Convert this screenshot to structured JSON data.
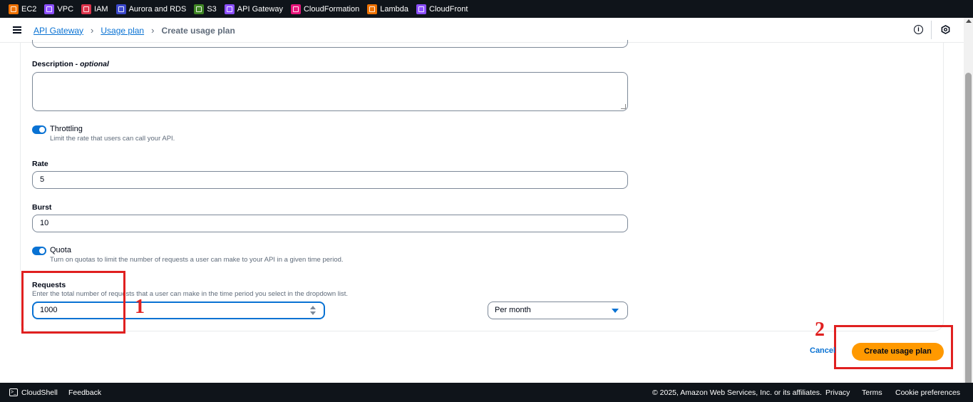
{
  "top_services": [
    {
      "label": "EC2",
      "color": "#ed7100",
      "icon": "ec2-icon"
    },
    {
      "label": "VPC",
      "color": "#8c4fff",
      "icon": "vpc-icon"
    },
    {
      "label": "IAM",
      "color": "#dd344c",
      "icon": "iam-icon"
    },
    {
      "label": "Aurora and RDS",
      "color": "#3b48cc",
      "icon": "rds-icon"
    },
    {
      "label": "S3",
      "color": "#3f8624",
      "icon": "s3-icon"
    },
    {
      "label": "API Gateway",
      "color": "#8c4fff",
      "icon": "api-gateway-icon"
    },
    {
      "label": "CloudFormation",
      "color": "#e7157b",
      "icon": "cloudformation-icon"
    },
    {
      "label": "Lambda",
      "color": "#ed7100",
      "icon": "lambda-icon"
    },
    {
      "label": "CloudFront",
      "color": "#8c4fff",
      "icon": "cloudfront-icon"
    }
  ],
  "breadcrumb": {
    "items": [
      "API Gateway",
      "Usage plan"
    ],
    "current": "Create usage plan",
    "separator": "›"
  },
  "header_icons": {
    "info": "i"
  },
  "form": {
    "description_label": "Description - ",
    "description_optional": "optional",
    "throttling_label": "Throttling",
    "throttling_desc": "Limit the rate that users can call your API.",
    "throttling_on": true,
    "rate_label": "Rate",
    "rate_value": "5",
    "burst_label": "Burst",
    "burst_value": "10",
    "quota_label": "Quota",
    "quota_desc": "Turn on quotas to limit the number of requests a user can make to your API in a given time period.",
    "quota_on": true,
    "requests_label": "Requests",
    "requests_desc": "Enter the total number of requests that a user can make in the time period you select in the dropdown list.",
    "requests_value": "1000",
    "period_value": "Per month"
  },
  "annotations": {
    "one": "1",
    "two": "2",
    "color": "#e02020"
  },
  "actions": {
    "cancel": "Cancel",
    "create": "Create usage plan"
  },
  "footer": {
    "cloudshell": "CloudShell",
    "feedback": "Feedback",
    "copyright": "© 2025, Amazon Web Services, Inc. or its affiliates.",
    "privacy": "Privacy",
    "terms": "Terms",
    "cookies": "Cookie preferences"
  },
  "colors": {
    "accent": "#0972d3",
    "primary": "#ff9900",
    "nav_bg": "#0f141a"
  }
}
